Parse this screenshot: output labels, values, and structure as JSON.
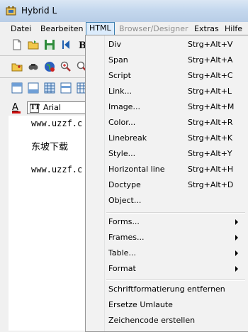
{
  "window": {
    "title": "Hybrid L"
  },
  "menubar": {
    "items": [
      {
        "label": "Datei",
        "state": "normal"
      },
      {
        "label": "Bearbeiten",
        "state": "normal"
      },
      {
        "label": "HTML",
        "state": "active"
      },
      {
        "label": "Browser/Designer",
        "state": "disabled"
      },
      {
        "label": "Extras",
        "state": "normal"
      },
      {
        "label": "Hilfe",
        "state": "normal"
      }
    ]
  },
  "font_toolbar": {
    "font_name": "Arial",
    "font_icon": "TT"
  },
  "editor": {
    "lines": [
      "www.uzzf.c",
      "东坡下载",
      "www.uzzf.c"
    ]
  },
  "html_menu": {
    "group1": [
      {
        "label": "Div",
        "shortcut": "Strg+Alt+V"
      },
      {
        "label": "Span",
        "shortcut": "Strg+Alt+A"
      },
      {
        "label": "Script",
        "shortcut": "Strg+Alt+C"
      },
      {
        "label": "Link...",
        "shortcut": "Strg+Alt+L"
      },
      {
        "label": "Image...",
        "shortcut": "Strg+Alt+M"
      },
      {
        "label": "Color...",
        "shortcut": "Strg+Alt+R"
      },
      {
        "label": "Linebreak",
        "shortcut": "Strg+Alt+K"
      },
      {
        "label": "Style...",
        "shortcut": "Strg+Alt+Y"
      },
      {
        "label": "Horizontal line",
        "shortcut": "Strg+Alt+H"
      },
      {
        "label": "Doctype",
        "shortcut": "Strg+Alt+D"
      },
      {
        "label": "Object...",
        "shortcut": ""
      }
    ],
    "group2": [
      {
        "label": "Forms...",
        "submenu": true
      },
      {
        "label": "Frames...",
        "submenu": true
      },
      {
        "label": "Table...",
        "submenu": true
      },
      {
        "label": "Format",
        "submenu": true
      }
    ],
    "group3": [
      {
        "label": "Schriftformatierung entfernen"
      },
      {
        "label": "Ersetze Umlaute"
      },
      {
        "label": "Zeichencode erstellen"
      }
    ]
  }
}
